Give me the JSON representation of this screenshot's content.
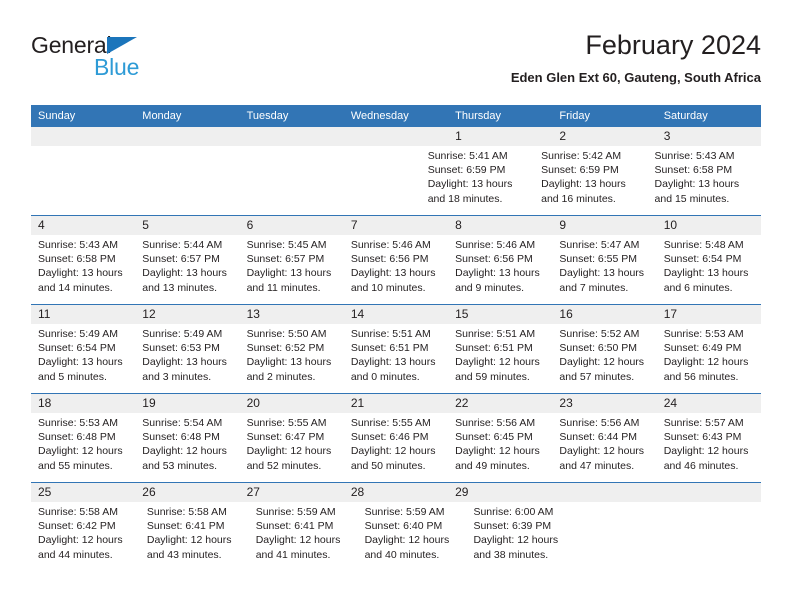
{
  "brand": {
    "name_part1": "General",
    "name_part2": "Blue"
  },
  "header": {
    "title": "February 2024",
    "subtitle": "Eden Glen Ext 60, Gauteng, South Africa"
  },
  "weekday_headers": [
    "Sunday",
    "Monday",
    "Tuesday",
    "Wednesday",
    "Thursday",
    "Friday",
    "Saturday"
  ],
  "colors": {
    "header_blue": "#3275b5",
    "date_band_gray": "#efefef",
    "brand_blue": "#1b75bb",
    "brand_light_blue": "#2e9bd6",
    "text": "#231f20"
  },
  "weeks": [
    [
      {
        "date": "",
        "sunrise": "",
        "sunset": "",
        "daylight": "",
        "daylight2": ""
      },
      {
        "date": "",
        "sunrise": "",
        "sunset": "",
        "daylight": "",
        "daylight2": ""
      },
      {
        "date": "",
        "sunrise": "",
        "sunset": "",
        "daylight": "",
        "daylight2": ""
      },
      {
        "date": "",
        "sunrise": "",
        "sunset": "",
        "daylight": "",
        "daylight2": ""
      },
      {
        "date": "1",
        "sunrise": "Sunrise: 5:41 AM",
        "sunset": "Sunset: 6:59 PM",
        "daylight": "Daylight: 13 hours",
        "daylight2": "and 18 minutes."
      },
      {
        "date": "2",
        "sunrise": "Sunrise: 5:42 AM",
        "sunset": "Sunset: 6:59 PM",
        "daylight": "Daylight: 13 hours",
        "daylight2": "and 16 minutes."
      },
      {
        "date": "3",
        "sunrise": "Sunrise: 5:43 AM",
        "sunset": "Sunset: 6:58 PM",
        "daylight": "Daylight: 13 hours",
        "daylight2": "and 15 minutes."
      }
    ],
    [
      {
        "date": "4",
        "sunrise": "Sunrise: 5:43 AM",
        "sunset": "Sunset: 6:58 PM",
        "daylight": "Daylight: 13 hours",
        "daylight2": "and 14 minutes."
      },
      {
        "date": "5",
        "sunrise": "Sunrise: 5:44 AM",
        "sunset": "Sunset: 6:57 PM",
        "daylight": "Daylight: 13 hours",
        "daylight2": "and 13 minutes."
      },
      {
        "date": "6",
        "sunrise": "Sunrise: 5:45 AM",
        "sunset": "Sunset: 6:57 PM",
        "daylight": "Daylight: 13 hours",
        "daylight2": "and 11 minutes."
      },
      {
        "date": "7",
        "sunrise": "Sunrise: 5:46 AM",
        "sunset": "Sunset: 6:56 PM",
        "daylight": "Daylight: 13 hours",
        "daylight2": "and 10 minutes."
      },
      {
        "date": "8",
        "sunrise": "Sunrise: 5:46 AM",
        "sunset": "Sunset: 6:56 PM",
        "daylight": "Daylight: 13 hours",
        "daylight2": "and 9 minutes."
      },
      {
        "date": "9",
        "sunrise": "Sunrise: 5:47 AM",
        "sunset": "Sunset: 6:55 PM",
        "daylight": "Daylight: 13 hours",
        "daylight2": "and 7 minutes."
      },
      {
        "date": "10",
        "sunrise": "Sunrise: 5:48 AM",
        "sunset": "Sunset: 6:54 PM",
        "daylight": "Daylight: 13 hours",
        "daylight2": "and 6 minutes."
      }
    ],
    [
      {
        "date": "11",
        "sunrise": "Sunrise: 5:49 AM",
        "sunset": "Sunset: 6:54 PM",
        "daylight": "Daylight: 13 hours",
        "daylight2": "and 5 minutes."
      },
      {
        "date": "12",
        "sunrise": "Sunrise: 5:49 AM",
        "sunset": "Sunset: 6:53 PM",
        "daylight": "Daylight: 13 hours",
        "daylight2": "and 3 minutes."
      },
      {
        "date": "13",
        "sunrise": "Sunrise: 5:50 AM",
        "sunset": "Sunset: 6:52 PM",
        "daylight": "Daylight: 13 hours",
        "daylight2": "and 2 minutes."
      },
      {
        "date": "14",
        "sunrise": "Sunrise: 5:51 AM",
        "sunset": "Sunset: 6:51 PM",
        "daylight": "Daylight: 13 hours",
        "daylight2": "and 0 minutes."
      },
      {
        "date": "15",
        "sunrise": "Sunrise: 5:51 AM",
        "sunset": "Sunset: 6:51 PM",
        "daylight": "Daylight: 12 hours",
        "daylight2": "and 59 minutes."
      },
      {
        "date": "16",
        "sunrise": "Sunrise: 5:52 AM",
        "sunset": "Sunset: 6:50 PM",
        "daylight": "Daylight: 12 hours",
        "daylight2": "and 57 minutes."
      },
      {
        "date": "17",
        "sunrise": "Sunrise: 5:53 AM",
        "sunset": "Sunset: 6:49 PM",
        "daylight": "Daylight: 12 hours",
        "daylight2": "and 56 minutes."
      }
    ],
    [
      {
        "date": "18",
        "sunrise": "Sunrise: 5:53 AM",
        "sunset": "Sunset: 6:48 PM",
        "daylight": "Daylight: 12 hours",
        "daylight2": "and 55 minutes."
      },
      {
        "date": "19",
        "sunrise": "Sunrise: 5:54 AM",
        "sunset": "Sunset: 6:48 PM",
        "daylight": "Daylight: 12 hours",
        "daylight2": "and 53 minutes."
      },
      {
        "date": "20",
        "sunrise": "Sunrise: 5:55 AM",
        "sunset": "Sunset: 6:47 PM",
        "daylight": "Daylight: 12 hours",
        "daylight2": "and 52 minutes."
      },
      {
        "date": "21",
        "sunrise": "Sunrise: 5:55 AM",
        "sunset": "Sunset: 6:46 PM",
        "daylight": "Daylight: 12 hours",
        "daylight2": "and 50 minutes."
      },
      {
        "date": "22",
        "sunrise": "Sunrise: 5:56 AM",
        "sunset": "Sunset: 6:45 PM",
        "daylight": "Daylight: 12 hours",
        "daylight2": "and 49 minutes."
      },
      {
        "date": "23",
        "sunrise": "Sunrise: 5:56 AM",
        "sunset": "Sunset: 6:44 PM",
        "daylight": "Daylight: 12 hours",
        "daylight2": "and 47 minutes."
      },
      {
        "date": "24",
        "sunrise": "Sunrise: 5:57 AM",
        "sunset": "Sunset: 6:43 PM",
        "daylight": "Daylight: 12 hours",
        "daylight2": "and 46 minutes."
      }
    ],
    [
      {
        "date": "25",
        "sunrise": "Sunrise: 5:58 AM",
        "sunset": "Sunset: 6:42 PM",
        "daylight": "Daylight: 12 hours",
        "daylight2": "and 44 minutes."
      },
      {
        "date": "26",
        "sunrise": "Sunrise: 5:58 AM",
        "sunset": "Sunset: 6:41 PM",
        "daylight": "Daylight: 12 hours",
        "daylight2": "and 43 minutes."
      },
      {
        "date": "27",
        "sunrise": "Sunrise: 5:59 AM",
        "sunset": "Sunset: 6:41 PM",
        "daylight": "Daylight: 12 hours",
        "daylight2": "and 41 minutes."
      },
      {
        "date": "28",
        "sunrise": "Sunrise: 5:59 AM",
        "sunset": "Sunset: 6:40 PM",
        "daylight": "Daylight: 12 hours",
        "daylight2": "and 40 minutes."
      },
      {
        "date": "29",
        "sunrise": "Sunrise: 6:00 AM",
        "sunset": "Sunset: 6:39 PM",
        "daylight": "Daylight: 12 hours",
        "daylight2": "and 38 minutes."
      },
      {
        "date": "",
        "sunrise": "",
        "sunset": "",
        "daylight": "",
        "daylight2": ""
      },
      {
        "date": "",
        "sunrise": "",
        "sunset": "",
        "daylight": "",
        "daylight2": ""
      }
    ]
  ]
}
